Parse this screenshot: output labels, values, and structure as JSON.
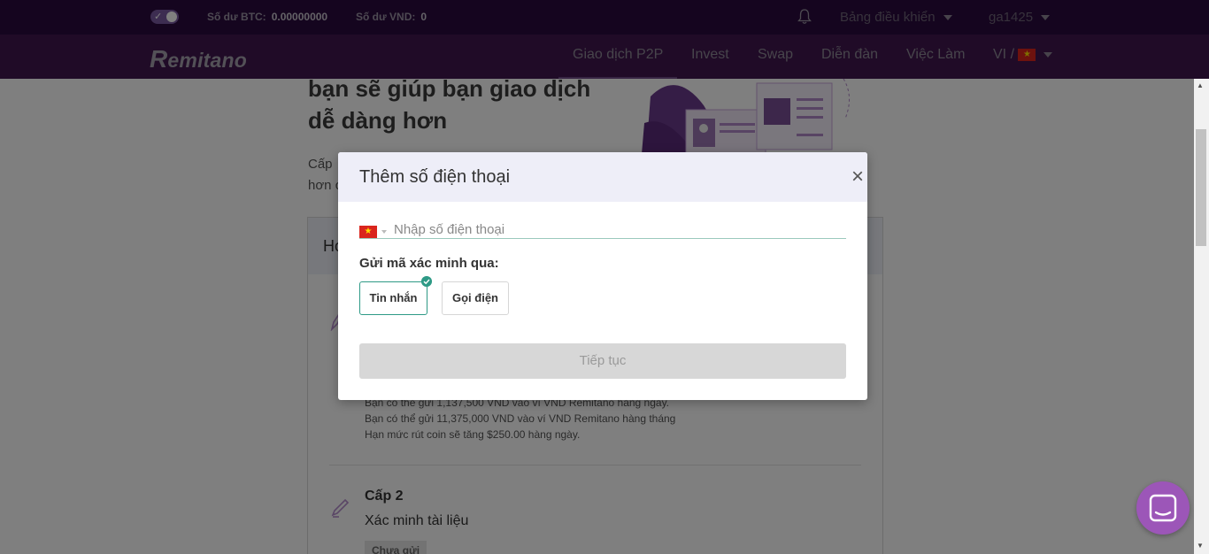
{
  "topbar": {
    "btc_label": "Số dư BTC:",
    "btc_value": "0.00000000",
    "vnd_label": "Số dư VND:",
    "vnd_value": "0",
    "dashboard": "Bảng điều khiển",
    "user": "ga1425"
  },
  "nav": {
    "logo": "emitano",
    "logo_r": "R",
    "items": [
      "Giao dịch P2P",
      "Invest",
      "Swap",
      "Diễn đàn",
      "Việc Làm"
    ],
    "lang": "VI /"
  },
  "page": {
    "heading": "bạn sẽ giúp bạn giao dịch dễ dàng hơn",
    "intro_line1": "Cấp",
    "intro_line2": "hơn c",
    "card_title": "Hơ",
    "lvl1_desc": [
      "Bạn có thể gửi 1,137,500 VND vào ví VND Remitano hàng ngày.",
      "Bạn có thể gửi 11,375,000 VND vào ví VND Remitano hàng tháng",
      "Hạn mức rút coin sẽ tăng $250.00 hàng ngày."
    ],
    "lvl2_title": "Cấp 2",
    "lvl2_sub": "Xác minh tài liệu",
    "lvl2_badge": "Chưa gửi"
  },
  "modal": {
    "title": "Thêm số điện thoại",
    "close": "×",
    "phone_placeholder": "Nhập số điện thoại",
    "send_via": "Gửi mã xác minh qua:",
    "option_sms": "Tin nhắn",
    "option_call": "Gọi điện",
    "continue": "Tiếp tục"
  },
  "colors": {
    "topbar_bg": "#2b0b3e",
    "navbar_bg": "#40164f",
    "accent_green": "#2e9a86",
    "chat_purple": "#9c56b8"
  }
}
